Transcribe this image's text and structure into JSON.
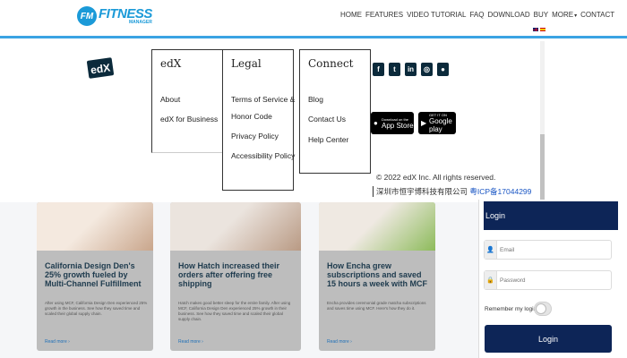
{
  "topnav": {
    "logo_badge": "FM",
    "logo_title": "FITNESS",
    "logo_subtitle": "MANAGER",
    "links": [
      "HOME",
      "FEATURES",
      "VIDEO TUTORIAL",
      "FAQ",
      "DOWNLOAD",
      "BUY",
      "MORE",
      "CONTACT"
    ],
    "more_arrow": "▾"
  },
  "footer": {
    "logo_text": "edX",
    "columns": {
      "edx": {
        "heading": "edX",
        "links": [
          "About",
          "edX for Business"
        ]
      },
      "legal": {
        "heading": "Legal",
        "links": [
          "Terms of Service &",
          "Honor Code",
          "Privacy Policy",
          "Accessibility Policy"
        ]
      },
      "connect": {
        "heading": "Connect",
        "links": [
          "Blog",
          "Contact Us",
          "Help Center"
        ]
      }
    },
    "social_icons": [
      "facebook-icon",
      "twitter-icon",
      "linkedin-icon",
      "instagram-icon",
      "reddit-icon"
    ],
    "appstore": {
      "line1": "Download on the",
      "line2": "App Store"
    },
    "googleplay": {
      "line1": "GET IT ON",
      "line2": "Google play"
    },
    "copyright": "© 2022 edX Inc. All rights reserved.",
    "icp_text": "深圳市恒宇博科技有限公司",
    "icp_link": "粤ICP备17044299"
  },
  "cards": [
    {
      "title": "California Design Den's 25% growth fueled by Multi-Channel Fulfillment",
      "body": "After using MCF, California Design Den experienced 25% growth in the business. See how they saved time and scaled their global supply chain.",
      "more": "Read more ›",
      "img_colors": [
        "#f4e9df",
        "#c9a68c"
      ]
    },
    {
      "title": "How Hatch increased their orders after offering free shipping",
      "body": "Hatch makes good better sleep for the entire family. After using MCF, California Design Den experienced 25% growth in their business. See how they saved time and scaled their global supply chain.",
      "more": "Read more ›",
      "img_colors": [
        "#ebe4de",
        "#b99a84"
      ]
    },
    {
      "title": "How Encha grew subscriptions and saved 15 hours a week with MCF",
      "body": "Encha provides ceremonial grade matcha subscriptions and saves time using MCF. Here's how they do it.",
      "more": "Read more ›",
      "img_colors": [
        "#efe9e2",
        "#8dbb5b"
      ]
    }
  ],
  "login": {
    "heading": "Login",
    "email_placeholder": "Email",
    "password_placeholder": "Password",
    "remember_label": "Remember my login",
    "remember_checked": false,
    "button_label": "Login"
  },
  "colors": {
    "brand_blue": "#1b9ad8",
    "navy": "#0d2557",
    "card_grey": "#bdbdbd"
  }
}
